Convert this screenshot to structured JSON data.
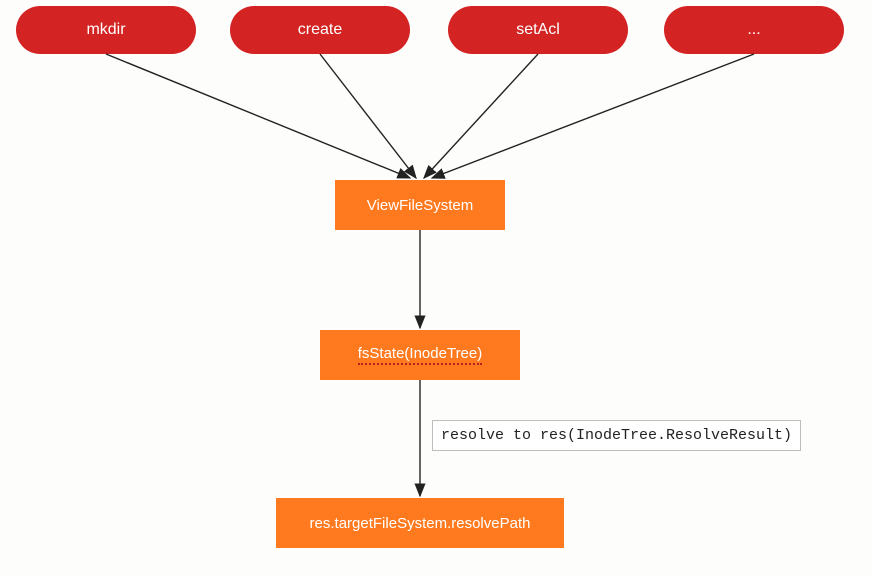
{
  "nodes": {
    "top": [
      {
        "id": "mkdir",
        "label": "mkdir"
      },
      {
        "id": "create",
        "label": "create"
      },
      {
        "id": "setacl",
        "label": "setAcl"
      },
      {
        "id": "more",
        "label": "..."
      }
    ],
    "viewfs": {
      "label": "ViewFileSystem"
    },
    "fsstate": {
      "label": "fsState(InodeTree)"
    },
    "resolvepath": {
      "label": "res.targetFileSystem.resolvePath"
    }
  },
  "annotation": {
    "resolve_note": "resolve to res(InodeTree.ResolveResult)"
  },
  "edges": [
    {
      "from": "mkdir",
      "to": "viewfs"
    },
    {
      "from": "create",
      "to": "viewfs"
    },
    {
      "from": "setacl",
      "to": "viewfs"
    },
    {
      "from": "more",
      "to": "viewfs"
    },
    {
      "from": "viewfs",
      "to": "fsstate"
    },
    {
      "from": "fsstate",
      "to": "resolvepath",
      "label": "resolve to res(InodeTree.ResolveResult)"
    }
  ],
  "colors": {
    "pill_bg": "#d32323",
    "box_bg": "#ff7a1f",
    "text_light": "#ffffff",
    "arrow": "#222222",
    "note_border": "#bdbdbd"
  }
}
